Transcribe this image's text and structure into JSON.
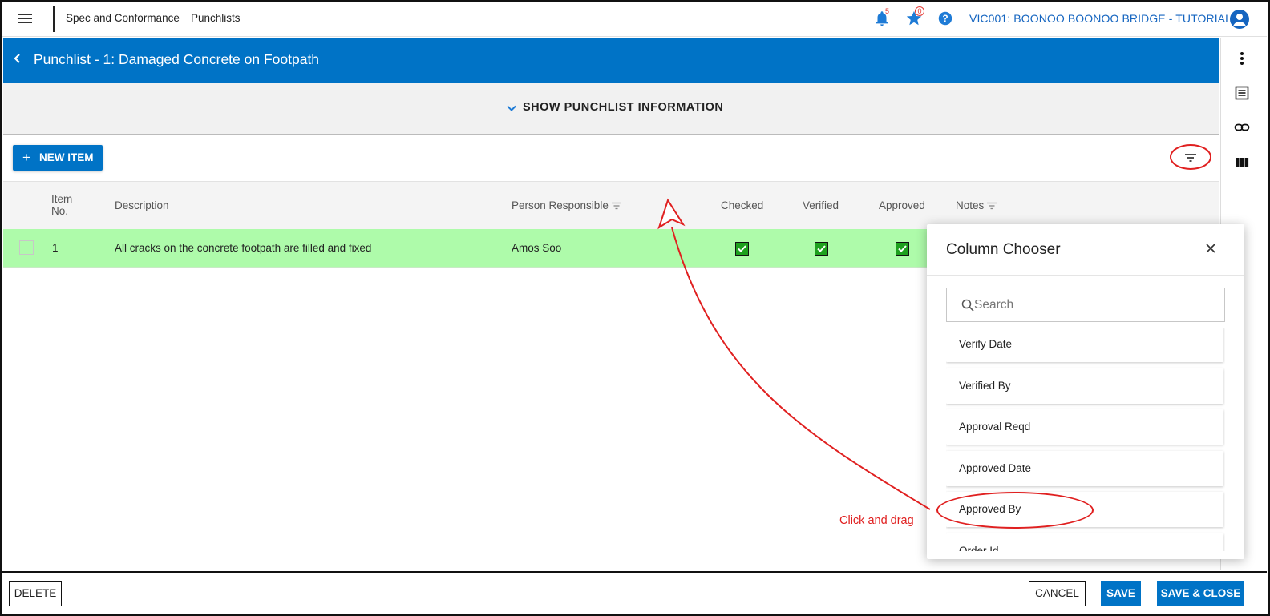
{
  "topbar": {
    "crumbs": [
      "Spec and Conformance",
      "Punchlists"
    ],
    "notifications_count": "5",
    "favorites_count": "0",
    "project": "VIC001: BOONOO BOONOO BRIDGE - TUTORIAL"
  },
  "titlebar": {
    "title": "Punchlist - 1: Damaged Concrete on Footpath"
  },
  "info": {
    "label": "SHOW PUNCHLIST INFORMATION"
  },
  "toolbar": {
    "new_item_label": "NEW ITEM"
  },
  "grid": {
    "headers": {
      "item_no_line1": "Item",
      "item_no_line2": "No.",
      "description": "Description",
      "person": "Person Responsible",
      "checked": "Checked",
      "verified": "Verified",
      "approved": "Approved",
      "notes": "Notes"
    },
    "rows": [
      {
        "item_no": "1",
        "description": "All cracks on the concrete footpath are filled and fixed",
        "person": "Amos Soo",
        "checked": true,
        "verified": true,
        "approved": true
      }
    ],
    "row_color": "#aefbaa"
  },
  "column_chooser": {
    "title": "Column Chooser",
    "search_placeholder": "Search",
    "items": [
      "Verify Date",
      "Verified By",
      "Approval Reqd",
      "Approved Date",
      "Approved By",
      "Order Id"
    ]
  },
  "annotation": {
    "text": "Click and drag",
    "color": "#e02020"
  },
  "footer": {
    "delete_label": "DELETE",
    "cancel_label": "CANCEL",
    "save_label": "SAVE",
    "save_close_label": "SAVE & CLOSE"
  },
  "colors": {
    "primary": "#0073c6",
    "accent_text": "#1565c0"
  }
}
